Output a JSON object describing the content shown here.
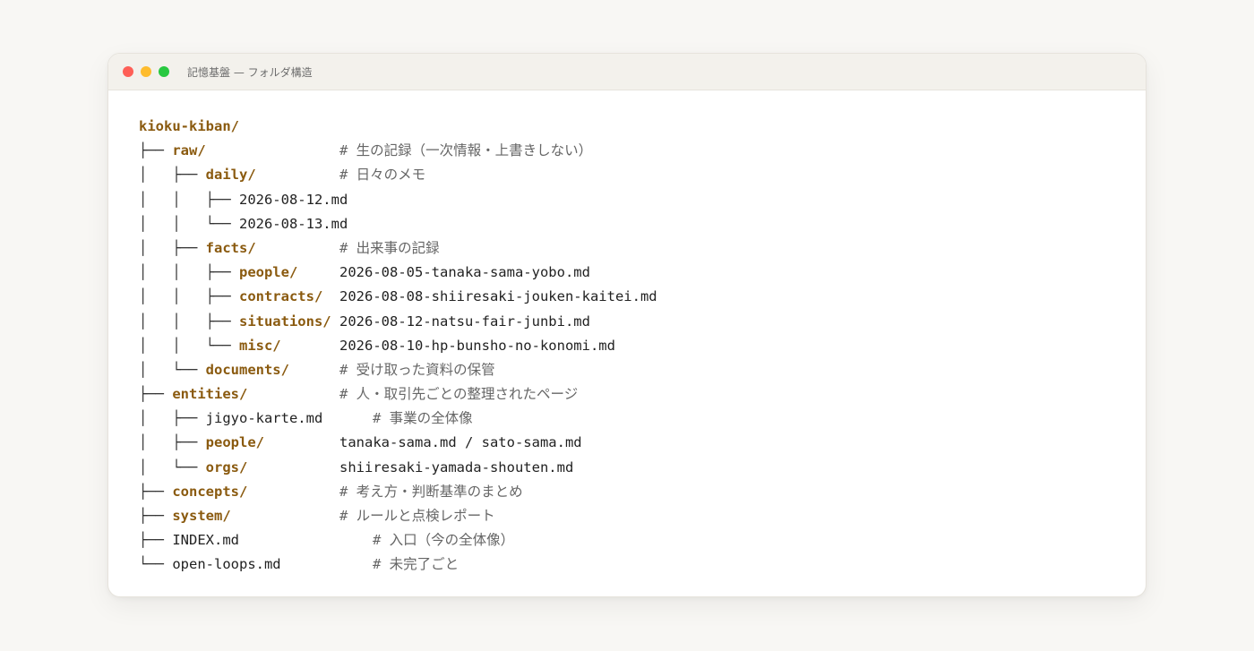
{
  "window": {
    "title": "記憶基盤 — フォルダ構造",
    "controls": [
      "close",
      "minimize",
      "zoom"
    ]
  },
  "colors": {
    "folder": "#8a5a0f",
    "comment": "#666666",
    "file": "#222222",
    "close": "#fe5f57",
    "minimize": "#febc2e",
    "zoom": "#28c840"
  },
  "tree": [
    {
      "prefix": "",
      "name": "kioku-kiban/",
      "kind": "dir",
      "right": "",
      "right_kind": ""
    },
    {
      "prefix": "├── ",
      "name": "raw/",
      "kind": "dir",
      "right": "# 生の記録（一次情報・上書きしない）",
      "right_kind": "comment"
    },
    {
      "prefix": "│   ├── ",
      "name": "daily/",
      "kind": "dir",
      "right": "# 日々のメモ",
      "right_kind": "comment"
    },
    {
      "prefix": "│   │   ├── ",
      "name": "2026-08-12.md",
      "kind": "file",
      "right": "",
      "right_kind": ""
    },
    {
      "prefix": "│   │   └── ",
      "name": "2026-08-13.md",
      "kind": "file",
      "right": "",
      "right_kind": ""
    },
    {
      "prefix": "│   ├── ",
      "name": "facts/",
      "kind": "dir",
      "right": "# 出来事の記録",
      "right_kind": "comment"
    },
    {
      "prefix": "│   │   ├── ",
      "name": "people/",
      "kind": "dir",
      "right": "2026-08-05-tanaka-sama-yobo.md",
      "right_kind": "file"
    },
    {
      "prefix": "│   │   ├── ",
      "name": "contracts/",
      "kind": "dir",
      "right": "2026-08-08-shiiresaki-jouken-kaitei.md",
      "right_kind": "file"
    },
    {
      "prefix": "│   │   ├── ",
      "name": "situations/",
      "kind": "dir",
      "right": "2026-08-12-natsu-fair-junbi.md",
      "right_kind": "file"
    },
    {
      "prefix": "│   │   └── ",
      "name": "misc/",
      "kind": "dir",
      "right": "2026-08-10-hp-bunsho-no-konomi.md",
      "right_kind": "file"
    },
    {
      "prefix": "│   └── ",
      "name": "documents/",
      "kind": "dir",
      "right": "# 受け取った資料の保管",
      "right_kind": "comment"
    },
    {
      "prefix": "├── ",
      "name": "entities/",
      "kind": "dir",
      "right": "# 人・取引先ごとの整理されたページ",
      "right_kind": "comment"
    },
    {
      "prefix": "│   ├── ",
      "name": "jigyo-karte.md",
      "kind": "file",
      "right": "# 事業の全体像",
      "right_kind": "comment-shift"
    },
    {
      "prefix": "│   ├── ",
      "name": "people/",
      "kind": "dir",
      "right": "tanaka-sama.md / sato-sama.md",
      "right_kind": "file"
    },
    {
      "prefix": "│   └── ",
      "name": "orgs/",
      "kind": "dir",
      "right": "shiiresaki-yamada-shouten.md",
      "right_kind": "file"
    },
    {
      "prefix": "├── ",
      "name": "concepts/",
      "kind": "dir",
      "right": "# 考え方・判断基準のまとめ",
      "right_kind": "comment"
    },
    {
      "prefix": "├── ",
      "name": "system/",
      "kind": "dir",
      "right": "# ルールと点検レポート",
      "right_kind": "comment"
    },
    {
      "prefix": "├── ",
      "name": "INDEX.md",
      "kind": "file",
      "right": "# 入口（今の全体像）",
      "right_kind": "comment-shift"
    },
    {
      "prefix": "└── ",
      "name": "open-loops.md",
      "kind": "file",
      "right": "# 未完了ごと",
      "right_kind": "comment-shift"
    }
  ]
}
